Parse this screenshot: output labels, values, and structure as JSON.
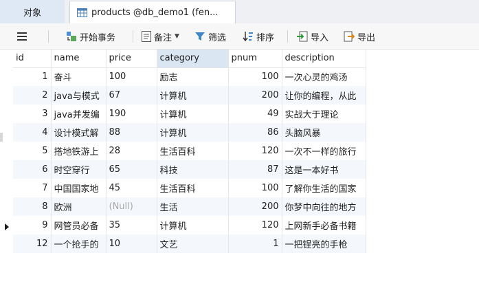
{
  "tabs": {
    "objects": "对象",
    "table": "products @db_demo1 (fen..."
  },
  "toolbar": {
    "begin_transaction": "开始事务",
    "memo": "备注",
    "filter": "筛选",
    "sort": "排序",
    "import": "导入",
    "export": "导出"
  },
  "grid": {
    "columns": [
      "id",
      "name",
      "price",
      "category",
      "pnum",
      "description"
    ],
    "active_column": "category",
    "current_row": 8,
    "rows": [
      [
        "1",
        "奋斗",
        "100",
        "励志",
        "100",
        "一次心灵的鸡汤"
      ],
      [
        "2",
        "java与模式",
        "67",
        "计算机",
        "200",
        "让你的编程，从此"
      ],
      [
        "3",
        "java并发编",
        "190",
        "计算机",
        "49",
        "实战大于理论"
      ],
      [
        "4",
        "设计模式解",
        "88",
        "计算机",
        "86",
        "头脑风暴"
      ],
      [
        "5",
        "搭地铁游上",
        "28",
        "生活百科",
        "120",
        "一次不一样的旅行"
      ],
      [
        "6",
        "时空穿行",
        "65",
        "科技",
        "87",
        "这是一本好书"
      ],
      [
        "7",
        "中国国家地",
        "45",
        "生活百科",
        "100",
        "了解你生活的国家"
      ],
      [
        "8",
        "欧洲",
        "(Null)",
        "生活",
        "200",
        "你梦中向往的地方"
      ],
      [
        "9",
        "网管员必备",
        "35",
        "计算机",
        "120",
        "上网新手必备书籍"
      ],
      [
        "12",
        "一个抢手的",
        "10",
        "文艺",
        "1",
        "一把锃亮的手枪"
      ]
    ]
  },
  "colors": {
    "header_active": "#dbe6f3",
    "tab_active": "#dfe9f6",
    "null_text": "#a9a9a9"
  }
}
